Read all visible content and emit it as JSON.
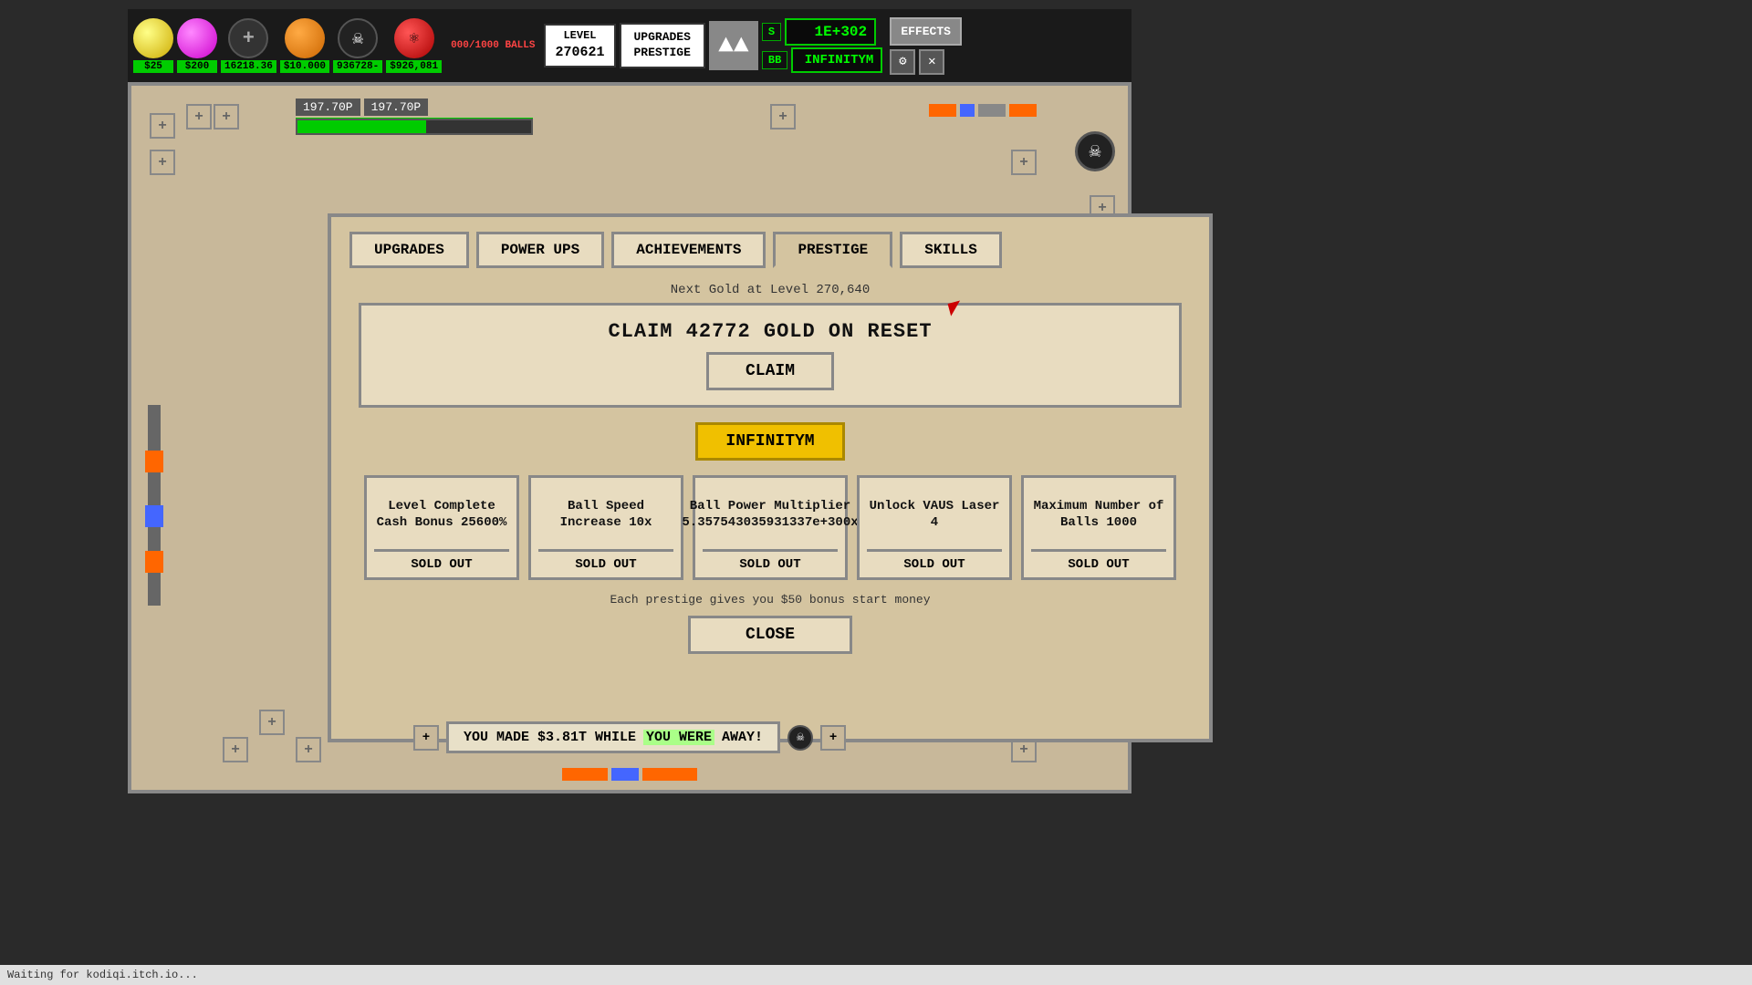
{
  "topbar": {
    "balls_counter": "000/1000\nBALLS",
    "level_label": "LEVEL",
    "level_value": "270621",
    "upgrades_prestige": "UPGRADES\nPRESTIGE",
    "money_value": "1E+302",
    "infinitym": "INFINITYM",
    "effects": "EFFECTS",
    "s_label": "S",
    "bb_label": "BB",
    "ball_prices": [
      "$25",
      "$200",
      "16218.36",
      "$10.000",
      "936728-",
      "$926,081"
    ]
  },
  "tabs": {
    "upgrades": "UPGRADES",
    "power_ups": "POWER UPS",
    "achievements": "ACHIEVEMENTS",
    "prestige": "PRESTIGE",
    "skills": "SKILLS"
  },
  "prestige_dialog": {
    "next_gold_text": "Next Gold at Level 270,640",
    "claim_text": "CLAIM 42772 GOLD ON RESET",
    "claim_btn": "CLAIM",
    "infinitym_btn": "INFINITYM",
    "items": [
      {
        "name": "Level Complete Cash Bonus 25600%",
        "sold": "SOLD OUT"
      },
      {
        "name": "Ball Speed Increase 10x",
        "sold": "SOLD OUT"
      },
      {
        "name": "Ball Power Multiplier 5.357543035931337e+300x",
        "sold": "SOLD OUT"
      },
      {
        "name": "Unlock VAUS Laser 4",
        "sold": "SOLD OUT"
      },
      {
        "name": "Maximum Number of Balls 1000",
        "sold": "SOLD OUT"
      }
    ],
    "bonus_text": "Each prestige gives you $50 bonus start money",
    "close_btn": "CLOSE"
  },
  "progress": {
    "val1": "197.70P",
    "val2": "197.70P",
    "fill_percent": 55
  },
  "notification": {
    "text_before": "YOU MADE $3.81T WHILE ",
    "text_highlight": "YOU WERE",
    "text_after": " AWAY!"
  },
  "status_bar": {
    "text": "Waiting for kodiqi.itch.io..."
  },
  "icons": {
    "gear": "⚙",
    "sound_off": "✕",
    "skull": "☠",
    "plus": "+"
  }
}
